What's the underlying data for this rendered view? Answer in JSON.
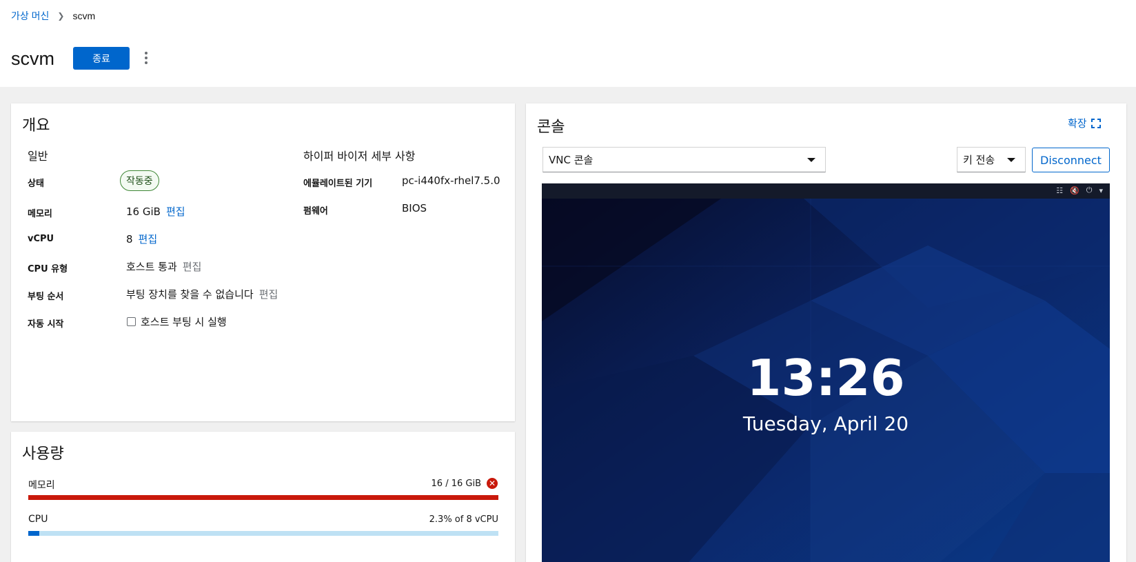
{
  "breadcrumb": {
    "parent": "가상 머신",
    "current": "scvm"
  },
  "page": {
    "title": "scvm",
    "stop_label": "종료"
  },
  "overview": {
    "title": "개요",
    "general": {
      "heading": "일반",
      "status_label": "상태",
      "status_value": "작동중",
      "memory_label": "메모리",
      "memory_value": "16 GiB",
      "vcpu_label": "vCPU",
      "vcpu_value": "8",
      "cpu_type_label": "CPU 유형",
      "cpu_type_value": "호스트 통과",
      "boot_order_label": "부팅 순서",
      "boot_order_value": "부팅 장치를 찾을 수 없습니다",
      "autostart_label": "자동 시작",
      "autostart_value": "호스트 부팅 시 실행",
      "edit_label": "편집"
    },
    "hypervisor": {
      "heading": "하이퍼 바이저 세부 사항",
      "machine_label": "에뮬레이트된 기기",
      "machine_value": "pc-i440fx-rhel7.5.0",
      "firmware_label": "펌웨어",
      "firmware_value": "BIOS"
    }
  },
  "usage": {
    "title": "사용량",
    "memory_label": "메모리",
    "memory_value": "16 / 16 GiB",
    "memory_fraction": 1.0,
    "cpu_label": "CPU",
    "cpu_value": "2.3% of 8 vCPU",
    "cpu_fraction": 0.023
  },
  "console": {
    "title": "콘솔",
    "expand_label": "확장",
    "type_select": "VNC 콘솔",
    "send_key": "키 전송",
    "disconnect": "Disconnect",
    "screen_time": "13:26",
    "screen_date": "Tuesday, April 20"
  },
  "colors": {
    "primary": "#0066cc",
    "danger": "#c9190b",
    "success": "#3e8635",
    "cpu_track": "#bee1f4"
  }
}
